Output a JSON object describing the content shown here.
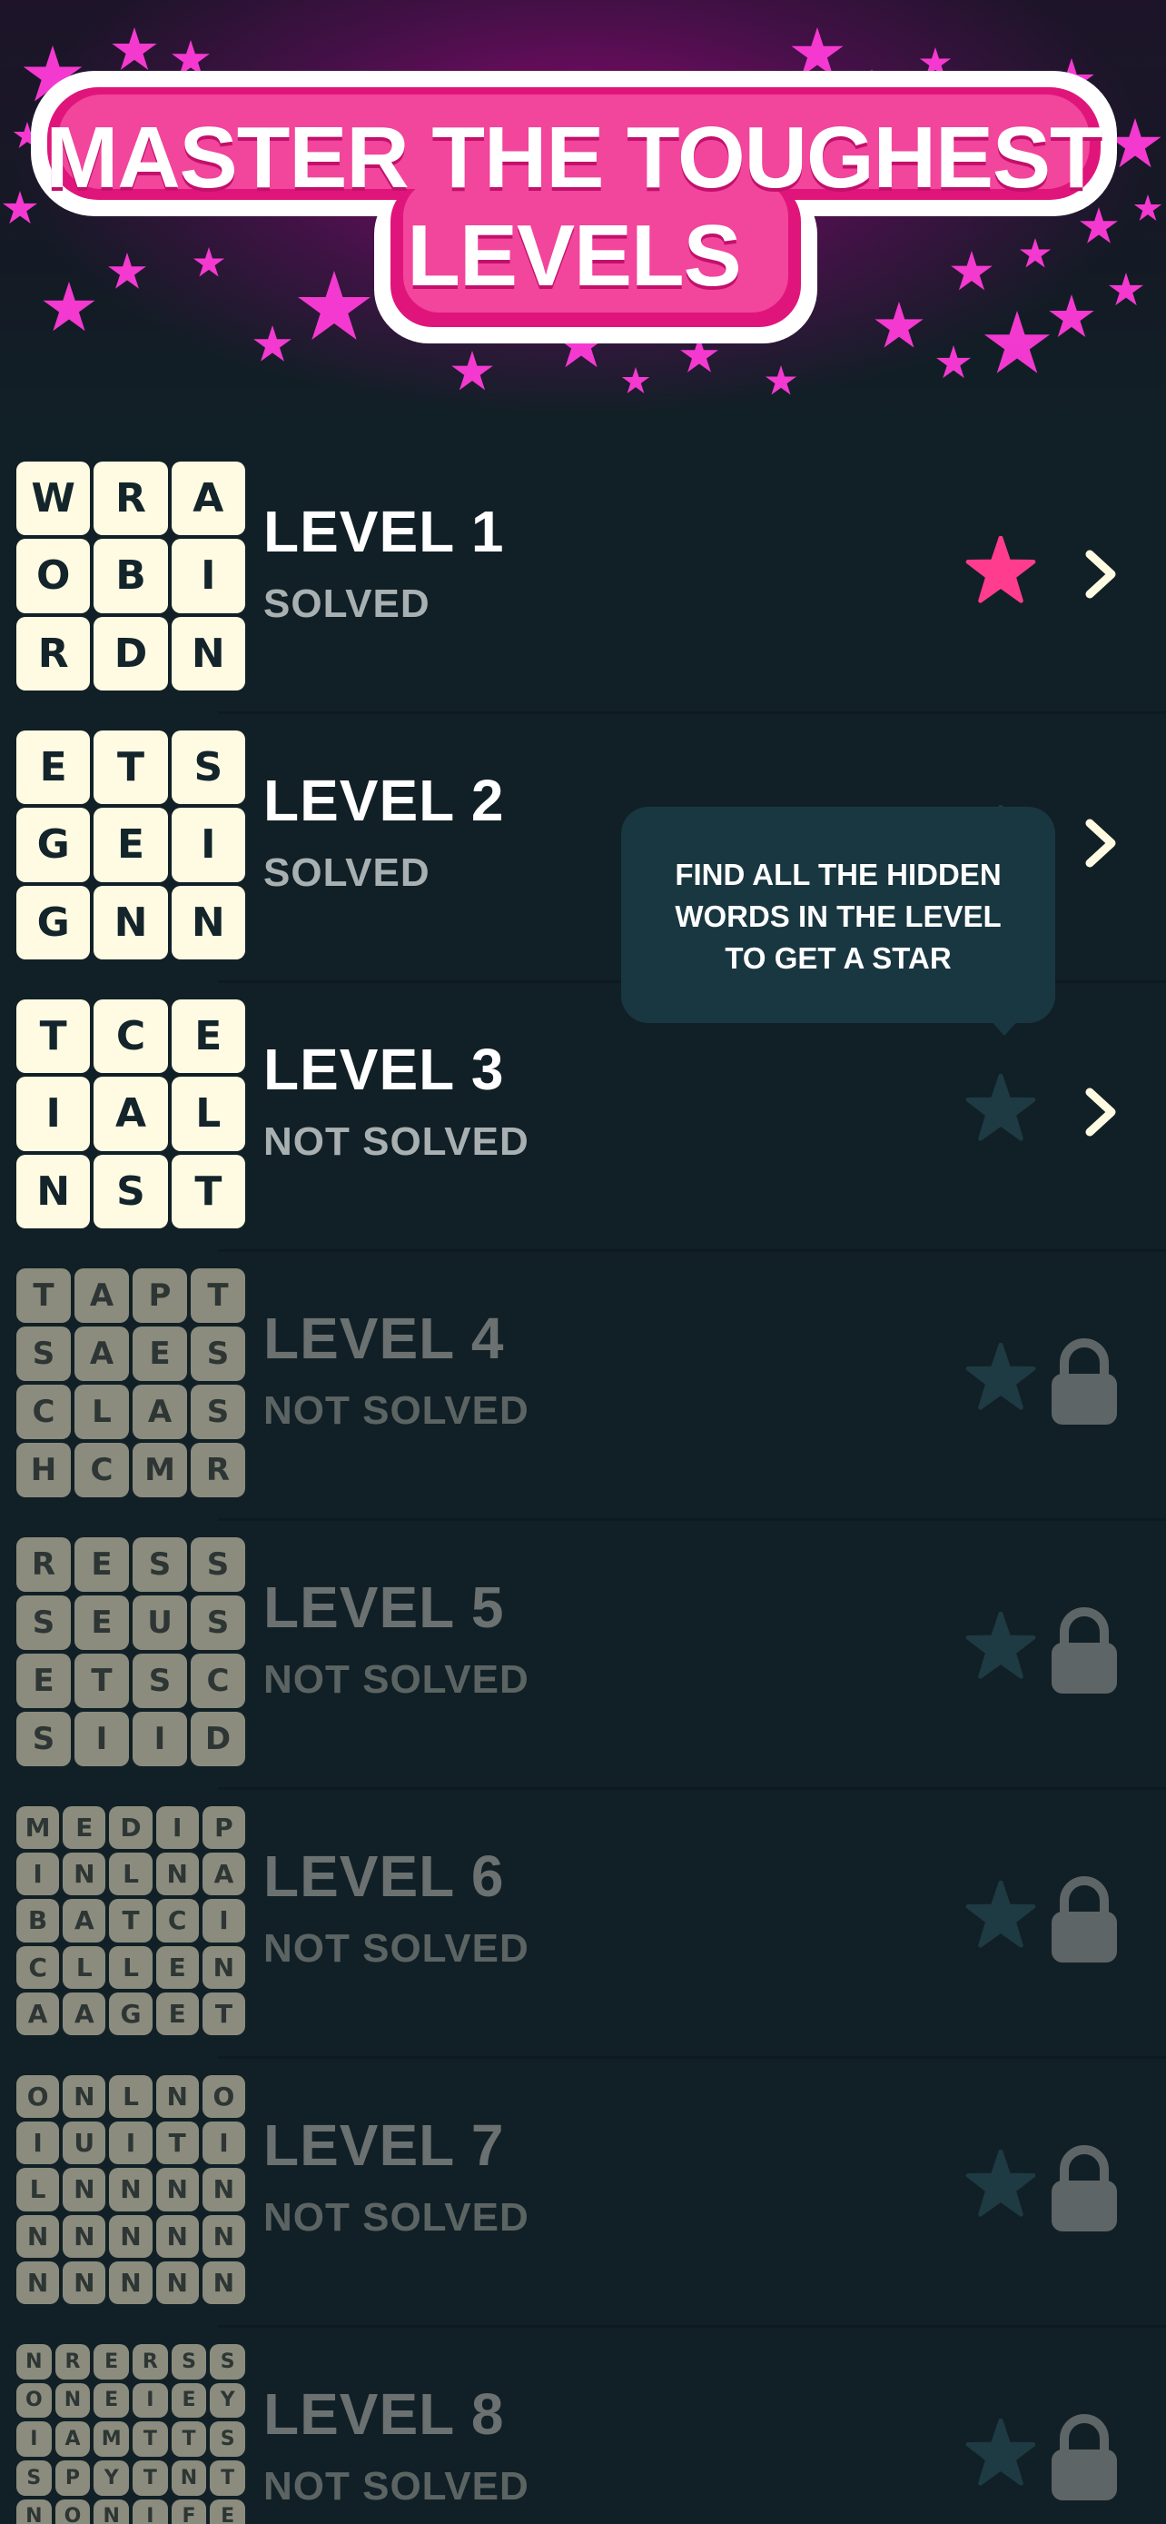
{
  "header": {
    "title_line1": "MASTER THE TOUGHEST",
    "title_line2": "LEVELS",
    "accent_color": "#e0157c",
    "star_color": "#ff3bd9"
  },
  "tooltip": {
    "text": "FIND ALL THE HIDDEN WORDS IN THE LEVEL TO GET A STAR"
  },
  "icons": {
    "star": "star-icon",
    "chevron": "chevron-right-icon",
    "lock": "lock-icon"
  },
  "colors": {
    "background": "#112026",
    "star_earned": "#ff3c8e",
    "star_unearned": "#1e3a43",
    "lock": "#5e6566",
    "tile_active": "#fefbe2",
    "tile_locked": "#8b8c7d"
  },
  "levels": [
    {
      "title": "LEVEL 1",
      "status": "SOLVED",
      "star": true,
      "locked": false,
      "grid": [
        [
          "W",
          "R",
          "A"
        ],
        [
          "O",
          "B",
          "I"
        ],
        [
          "R",
          "D",
          "N"
        ]
      ]
    },
    {
      "title": "LEVEL 2",
      "status": "SOLVED",
      "star": false,
      "locked": false,
      "grid": [
        [
          "E",
          "T",
          "S"
        ],
        [
          "G",
          "E",
          "I"
        ],
        [
          "G",
          "N",
          "N"
        ]
      ]
    },
    {
      "title": "LEVEL 3",
      "status": "NOT SOLVED",
      "star": false,
      "locked": false,
      "grid": [
        [
          "T",
          "C",
          "E"
        ],
        [
          "I",
          "A",
          "L"
        ],
        [
          "N",
          "S",
          "T"
        ]
      ]
    },
    {
      "title": "LEVEL 4",
      "status": "NOT SOLVED",
      "star": false,
      "locked": true,
      "grid": [
        [
          "T",
          "A",
          "P",
          "T"
        ],
        [
          "S",
          "A",
          "E",
          "S"
        ],
        [
          "C",
          "L",
          "A",
          "S"
        ],
        [
          "H",
          "C",
          "M",
          "R"
        ]
      ]
    },
    {
      "title": "LEVEL 5",
      "status": "NOT SOLVED",
      "star": false,
      "locked": true,
      "grid": [
        [
          "R",
          "E",
          "S",
          "S"
        ],
        [
          "S",
          "E",
          "U",
          "S"
        ],
        [
          "E",
          "T",
          "S",
          "C"
        ],
        [
          "S",
          "I",
          "I",
          "D"
        ]
      ]
    },
    {
      "title": "LEVEL 6",
      "status": "NOT SOLVED",
      "star": false,
      "locked": true,
      "grid": [
        [
          "M",
          "E",
          "D",
          "I",
          "P"
        ],
        [
          "I",
          "N",
          "L",
          "N",
          "A"
        ],
        [
          "B",
          "A",
          "T",
          "C",
          "I"
        ],
        [
          "C",
          "L",
          "L",
          "E",
          "N"
        ],
        [
          "A",
          "A",
          "G",
          "E",
          "T"
        ]
      ]
    },
    {
      "title": "LEVEL 7",
      "status": "NOT SOLVED",
      "star": false,
      "locked": true,
      "grid": [
        [
          "O",
          "N",
          "L",
          "N",
          "O"
        ],
        [
          "I",
          "U",
          "I",
          "T",
          "I"
        ],
        [
          "L",
          "N",
          "N",
          "N",
          "N"
        ],
        [
          "N",
          "N",
          "N",
          "N",
          "N"
        ],
        [
          "N",
          "N",
          "N",
          "N",
          "N"
        ]
      ]
    },
    {
      "title": "LEVEL 8",
      "status": "NOT SOLVED",
      "star": false,
      "locked": true,
      "grid": [
        [
          "N",
          "R",
          "E",
          "R",
          "S",
          "S"
        ],
        [
          "O",
          "N",
          "E",
          "I",
          "E",
          "Y"
        ],
        [
          "I",
          "A",
          "M",
          "T",
          "T",
          "S"
        ],
        [
          "S",
          "P",
          "Y",
          "T",
          "N",
          "T"
        ],
        [
          "N",
          "O",
          "N",
          "I",
          "F",
          "E"
        ],
        [
          "",
          "",
          "",
          "",
          "",
          ""
        ]
      ]
    }
  ]
}
